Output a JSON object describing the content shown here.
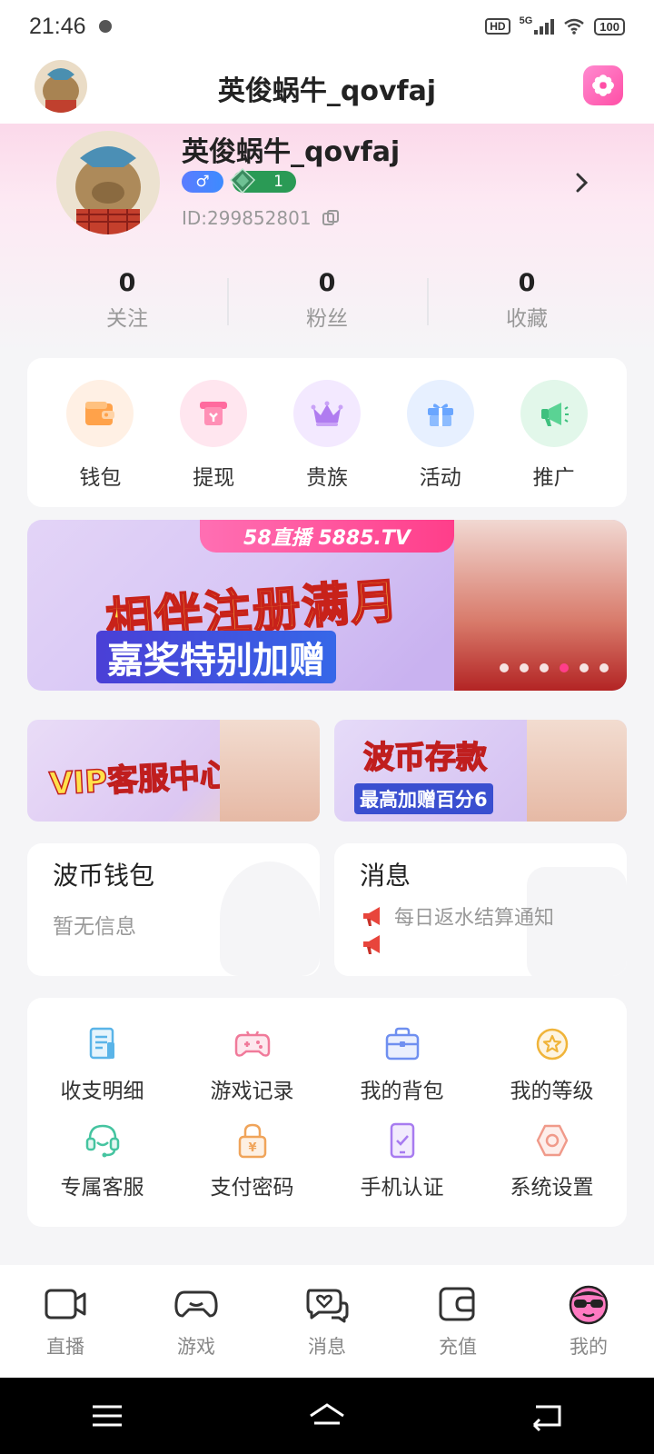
{
  "status": {
    "time": "21:46",
    "hd": "HD",
    "network": "5G",
    "battery": "100"
  },
  "header": {
    "title": "英俊蜗牛_qovfaj"
  },
  "profile": {
    "name": "英俊蜗牛_qovfaj",
    "gender_symbol": "♂",
    "level": "1",
    "id_text": "ID:299852801"
  },
  "stats": [
    {
      "value": "0",
      "label": "关注"
    },
    {
      "value": "0",
      "label": "粉丝"
    },
    {
      "value": "0",
      "label": "收藏"
    }
  ],
  "quick_actions": [
    {
      "label": "钱包",
      "icon": "wallet-icon",
      "color": "#ffa24a",
      "bg": "#fff0e4"
    },
    {
      "label": "提现",
      "icon": "withdraw-icon",
      "color": "#ff6b9e",
      "bg": "#ffe6ef"
    },
    {
      "label": "贵族",
      "icon": "crown-icon",
      "color": "#b07cf0",
      "bg": "#f3e9ff"
    },
    {
      "label": "活动",
      "icon": "gift-icon",
      "color": "#6aa6ff",
      "bg": "#e7f0ff"
    },
    {
      "label": "推广",
      "icon": "megaphone-icon",
      "color": "#3ec07e",
      "bg": "#e2f7ea"
    }
  ],
  "banner": {
    "top_label": "58直播 5885.TV",
    "headline": "相伴注册满月",
    "subline": "嘉奖特别加赠",
    "active_dot": 3,
    "dot_count": 6
  },
  "promos": [
    {
      "title": "VIP客服中心"
    },
    {
      "title": "波币存款",
      "subtitle": "最高加赠百分6"
    }
  ],
  "wallet_card": {
    "title": "波币钱包",
    "subtitle": "暂无信息"
  },
  "message_card": {
    "title": "消息",
    "items": [
      "每日返水结算通知",
      ""
    ]
  },
  "menu": [
    {
      "label": "收支明细",
      "icon": "ledger-icon",
      "color": "#5ab4e8"
    },
    {
      "label": "游戏记录",
      "icon": "gamepad-icon",
      "color": "#f07a9a"
    },
    {
      "label": "我的背包",
      "icon": "bag-icon",
      "color": "#6f8ff0"
    },
    {
      "label": "我的等级",
      "icon": "star-badge-icon",
      "color": "#f0b43a"
    },
    {
      "label": "专属客服",
      "icon": "headset-icon",
      "color": "#45c4a0"
    },
    {
      "label": "支付密码",
      "icon": "lock-icon",
      "color": "#f0a45a"
    },
    {
      "label": "手机认证",
      "icon": "phone-check-icon",
      "color": "#a77bf0"
    },
    {
      "label": "系统设置",
      "icon": "settings-hex-icon",
      "color": "#f09a8a"
    }
  ],
  "tabs": [
    {
      "label": "直播",
      "icon": "live-camera-icon"
    },
    {
      "label": "游戏",
      "icon": "gamepad-icon"
    },
    {
      "label": "消息",
      "icon": "chat-heart-icon"
    },
    {
      "label": "充值",
      "icon": "wallet-icon"
    },
    {
      "label": "我的",
      "icon": "profile-face-icon",
      "active": true
    }
  ],
  "colors": {
    "accent": "#ff4fa6",
    "level_green": "#2a9a55",
    "gender_blue": "#4a84ff"
  }
}
